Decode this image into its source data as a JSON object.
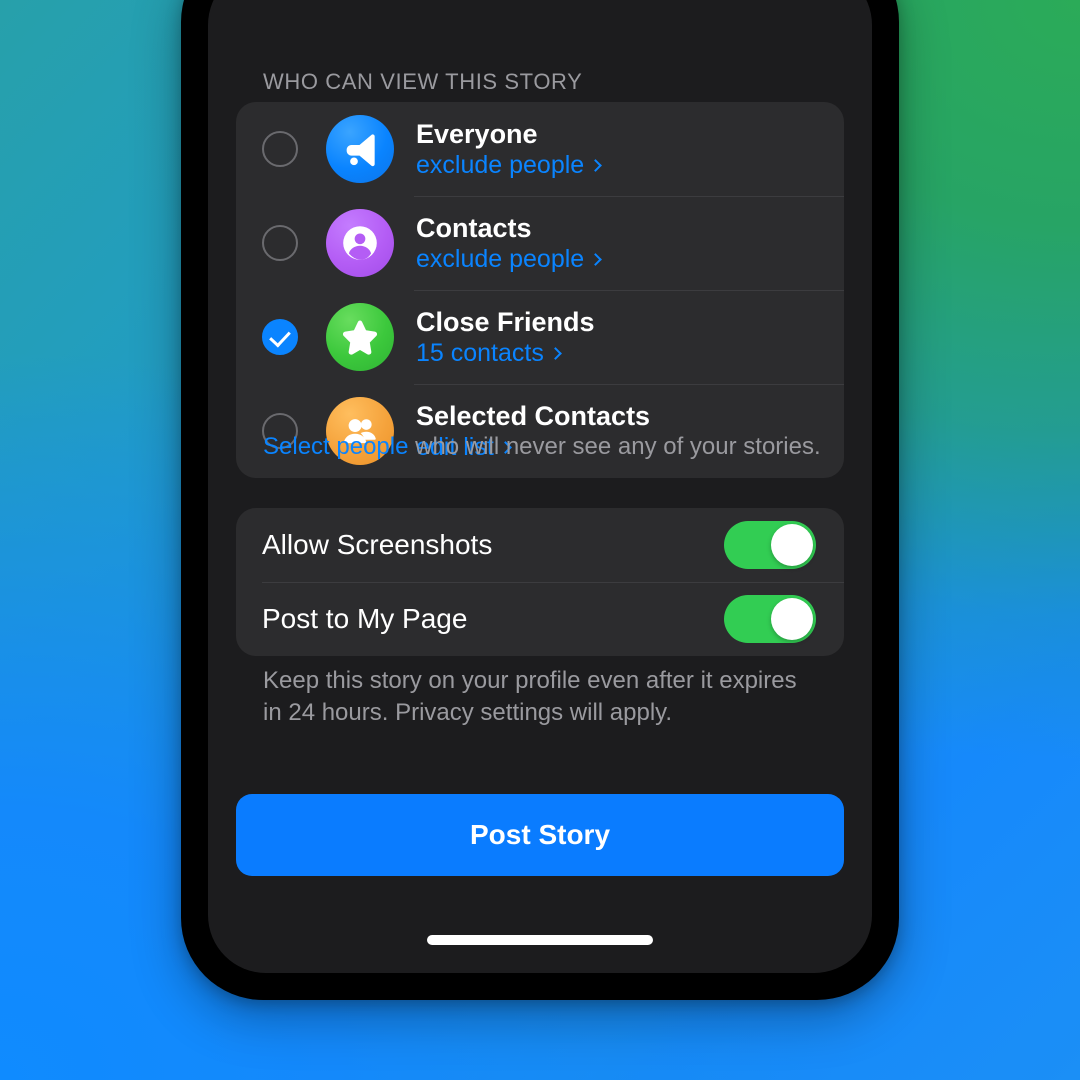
{
  "background": {
    "gradient_from": "#27a0aa",
    "gradient_green": "#27a465",
    "gradient_blue": "#1689fb"
  },
  "screen": {
    "section_header": "WHO CAN VIEW THIS STORY",
    "audience": {
      "options": [
        {
          "title": "Everyone",
          "sublabel": "exclude people",
          "selected": false,
          "icon": "megaphone-icon",
          "icon_color": "#1a8fff"
        },
        {
          "title": "Contacts",
          "sublabel": "exclude people",
          "selected": false,
          "icon": "person-icon",
          "icon_color": "#b45df5"
        },
        {
          "title": "Close Friends",
          "sublabel": "15 contacts",
          "selected": true,
          "icon": "star-icon",
          "icon_color": "#3cc83c"
        },
        {
          "title": "Selected Contacts",
          "sublabel": "edit list",
          "selected": false,
          "icon": "group-icon",
          "icon_color": "#f5a33c"
        }
      ],
      "footnote_link": "Select people",
      "footnote_rest": " who will never see any of your stories."
    },
    "toggles": [
      {
        "label": "Allow Screenshots",
        "on": true
      },
      {
        "label": "Post to My Page",
        "on": true
      }
    ],
    "toggles_footnote": "Keep this story on your profile even after it expires in 24 hours. Privacy settings will apply.",
    "post_button": "Post Story",
    "accent_blue": "#0a84ff",
    "switch_green": "#32cd53",
    "button_blue": "#0a7cff"
  }
}
